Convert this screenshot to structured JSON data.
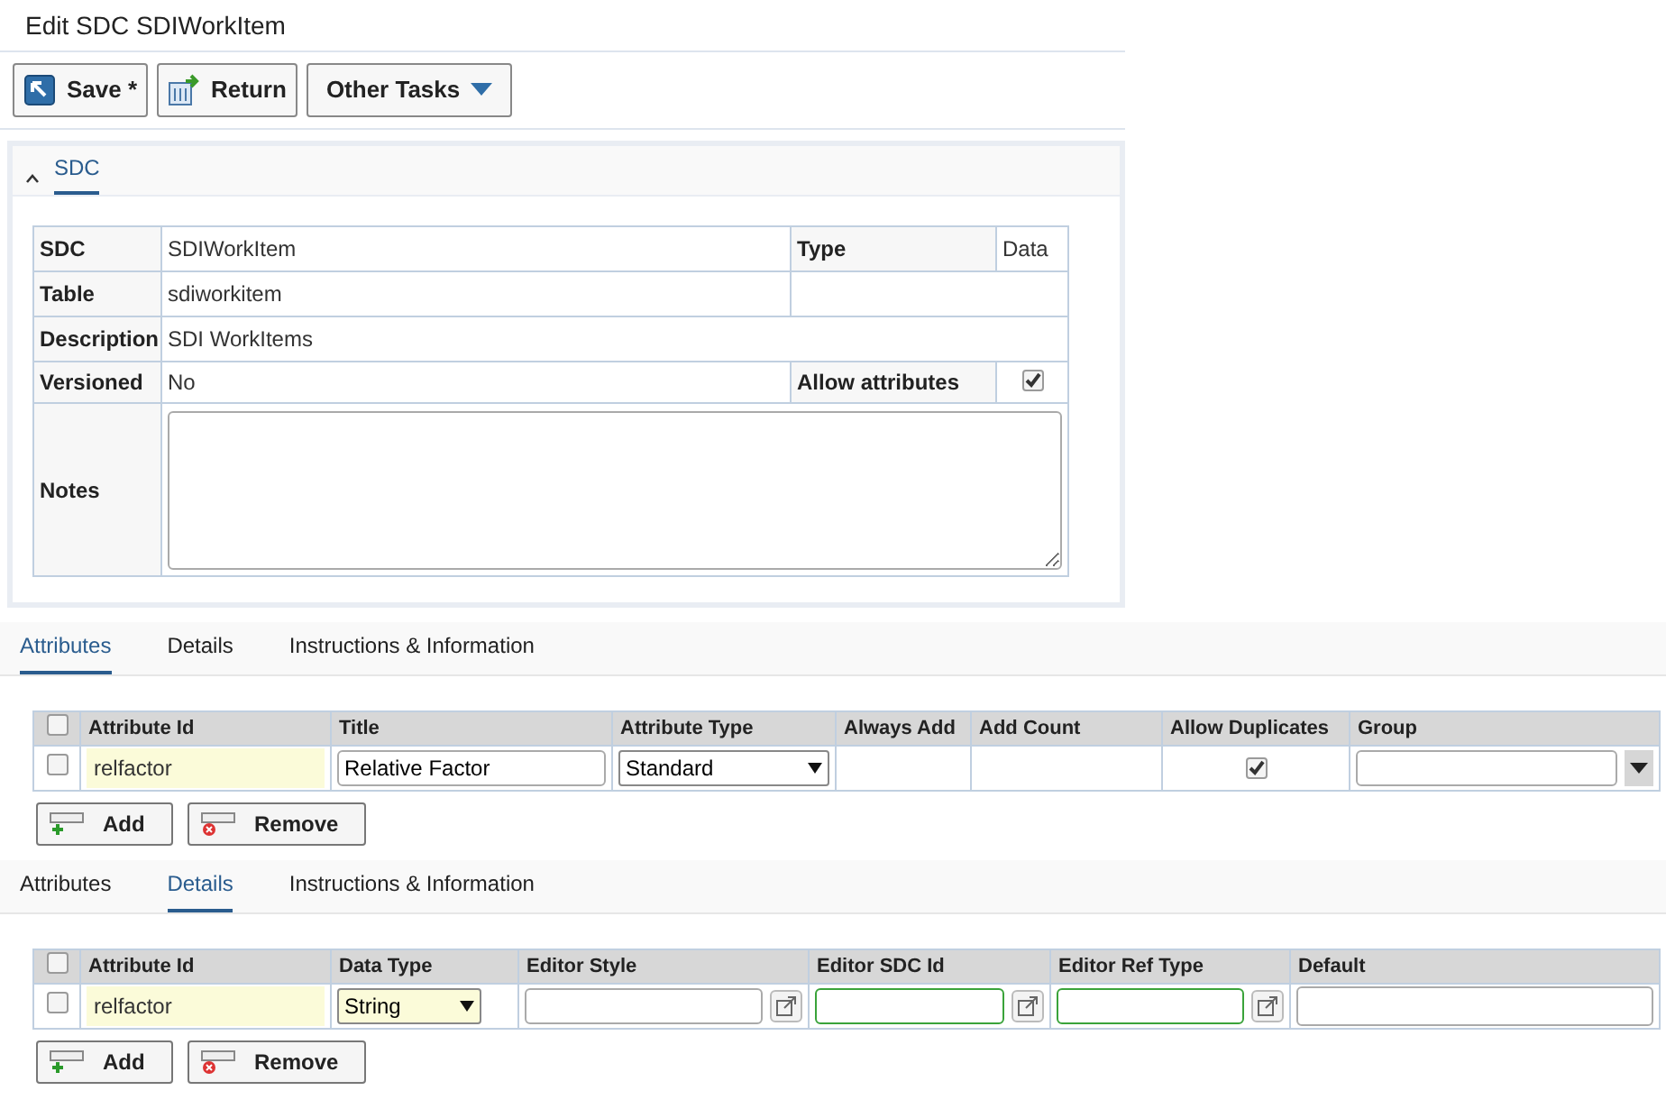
{
  "page_title": "Edit SDC SDIWorkItem",
  "toolbar": [
    {
      "label": "Save *",
      "kind": "save"
    },
    {
      "label": "Return",
      "kind": "return"
    },
    {
      "label": "Other Tasks",
      "kind": "menu"
    }
  ],
  "section": {
    "title": "SDC",
    "expanded": true,
    "sdc_label": "SDC",
    "sdc_value": "SDIWorkItem",
    "type_label": "Type",
    "type_value": "Data",
    "table_label": "Table",
    "table_value": "sdiworkitem",
    "description_label": "Description",
    "description_value": "SDI WorkItems",
    "versioned_label": "Versioned",
    "versioned_value": "No",
    "allow_attributes_label": "Allow attributes",
    "allow_attributes_checked": true,
    "notes_label": "Notes"
  },
  "panels": [
    {
      "tabs": [
        {
          "label": "Attributes",
          "selected": true
        },
        {
          "label": "Details",
          "selected": false
        },
        {
          "label": "Instructions & Information",
          "selected": false
        }
      ],
      "all_checked": false,
      "columns": [
        "Attribute Id",
        "Title",
        "Attribute Type",
        "Always Add",
        "Add Count",
        "Allow Duplicates",
        "Group"
      ],
      "rows": [
        {
          "checked": false,
          "cells": [
            {
              "kind": "readonly",
              "value": "relfactor"
            },
            {
              "kind": "input",
              "value": "Relative Factor"
            },
            {
              "kind": "select",
              "value": "Standard"
            },
            {
              "kind": "empty"
            },
            {
              "kind": "empty"
            },
            {
              "kind": "checkbox",
              "checked": true
            },
            {
              "kind": "combo"
            }
          ]
        }
      ],
      "buttons": [
        {
          "label": "Add",
          "kind": "add"
        },
        {
          "label": "Remove",
          "kind": "remove"
        }
      ]
    },
    {
      "tabs": [
        {
          "label": "Attributes",
          "selected": false
        },
        {
          "label": "Details",
          "selected": true
        },
        {
          "label": "Instructions & Information",
          "selected": false
        }
      ],
      "all_checked": false,
      "columns": [
        "Attribute Id",
        "Data Type",
        "Editor Style",
        "Editor SDC Id",
        "Editor Ref Type",
        "Default"
      ],
      "rows": [
        {
          "checked": false,
          "cells": [
            {
              "kind": "readonly",
              "value": "relfactor"
            },
            {
              "kind": "yellow_select",
              "value": "String"
            },
            {
              "kind": "link_input",
              "required": false
            },
            {
              "kind": "link_input",
              "required": true
            },
            {
              "kind": "link_input",
              "required": true
            },
            {
              "kind": "textarea"
            }
          ]
        }
      ],
      "buttons": [
        {
          "label": "Add",
          "kind": "add"
        },
        {
          "label": "Remove",
          "kind": "remove"
        }
      ]
    }
  ]
}
